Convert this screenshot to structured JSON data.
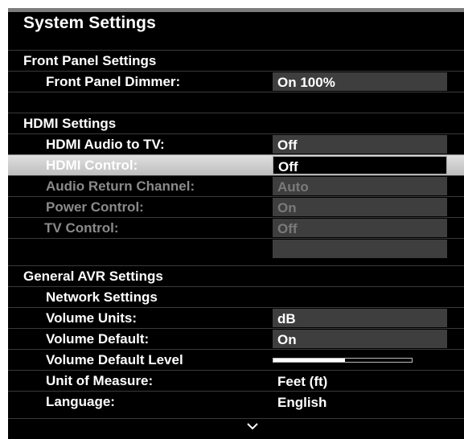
{
  "window": {
    "title": "System Settings"
  },
  "sections": {
    "front_panel": "Front Panel Settings",
    "hdmi": "HDMI Settings",
    "general": "General AVR Settings"
  },
  "settings": {
    "front_panel_dimmer": {
      "label": "Front Panel Dimmer:",
      "value": "On 100%"
    },
    "hdmi_audio_to_tv": {
      "label": "HDMI Audio to TV:",
      "value": "Off"
    },
    "hdmi_control": {
      "label": "HDMI Control:",
      "value": "Off"
    },
    "audio_return_channel": {
      "label": "Audio Return Channel:",
      "value": "Auto"
    },
    "power_control": {
      "label": "Power Control:",
      "value": "On"
    },
    "tv_control": {
      "label": "TV Control:",
      "value": "Off"
    },
    "network_settings": {
      "label": "Network Settings"
    },
    "volume_units": {
      "label": "Volume Units:",
      "value": "dB"
    },
    "volume_default": {
      "label": "Volume Default:",
      "value": "On"
    },
    "volume_default_level": {
      "label": "Volume Default Level",
      "level_fraction": 0.52
    },
    "unit_of_measure": {
      "label": "Unit of Measure:",
      "value": "Feet (ft)"
    },
    "language": {
      "label": "Language:",
      "value": "English"
    }
  },
  "icons": {
    "scroll_down": "chevron-down-icon"
  },
  "colors": {
    "background": "#000000",
    "value_box": "#3e3e3e",
    "highlight": "#d6d6d6",
    "disabled_text": "#8a8a8a"
  }
}
